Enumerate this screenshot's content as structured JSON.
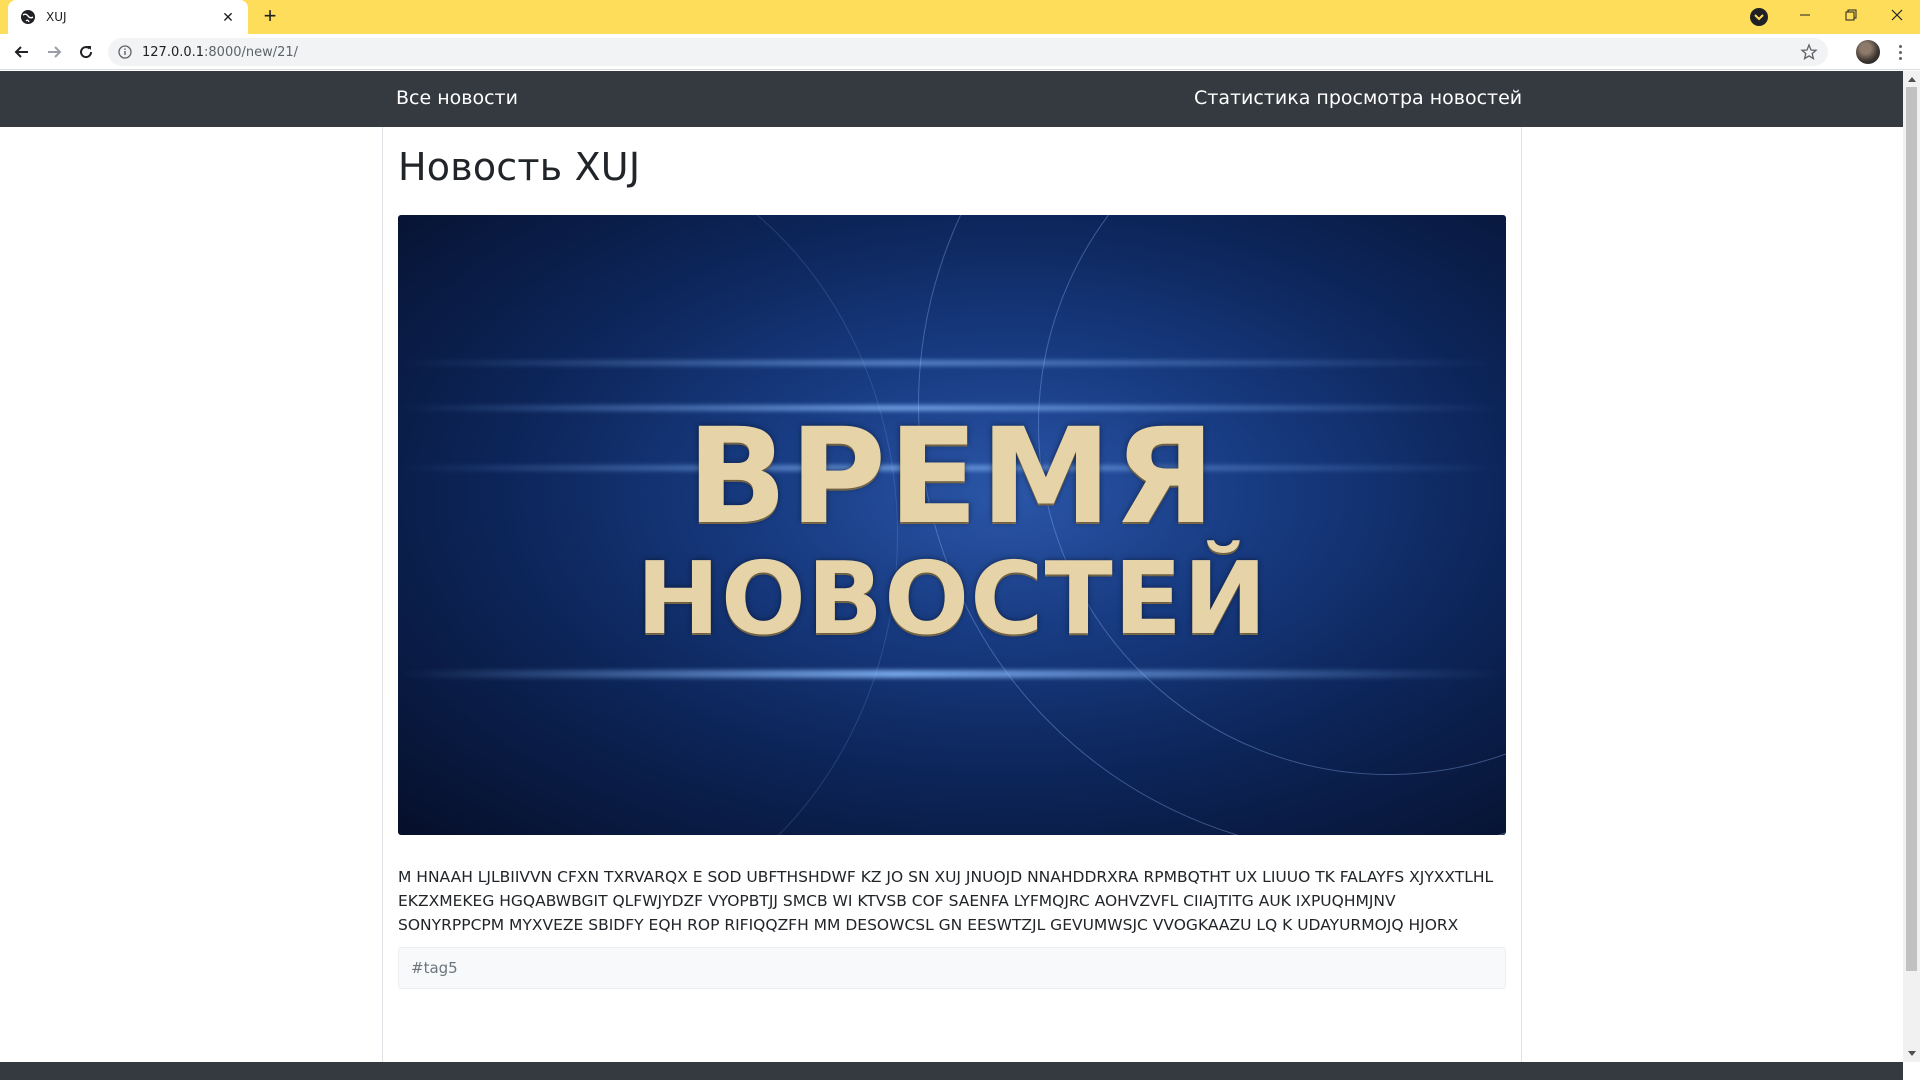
{
  "browser": {
    "tab_title": "XUJ",
    "url_host": "127.0.0.1",
    "url_rest": ":8000/new/21/",
    "accent_color": "#fedd5a"
  },
  "navbar": {
    "all_news": "Все новости",
    "stats": "Статистика просмотра новостей"
  },
  "article": {
    "title": "Новость XUJ",
    "image_text_line1": "ВРЕМЯ",
    "image_text_line2": "НОВОСТЕЙ",
    "body": "M HNAAH LJLBIIVVN CFXN TXRVARQX E SOD UBFTHSHDWF KZ JO SN XUJ JNUOJD NNAHDDRXRA RPMBQTHT UX LIUUO TK FALAYFS XJYXXTLHL EKZXMEKEG HGQABWBGIT QLFWJYDZF VYOPBTJJ SMCB WI KTVSB COF SAENFA LYFMQJRC AOHVZVFL CIIAJTITG AUK IXPUQHMJNV SONYRPPCPM MYXVEZE SBIDFY EQH ROP RIFIQQZFH MM DESOWCSL GN EESWTZJL GEVUMWSJC VVOGKAAZU LQ K UDAYURMOJQ HJORX",
    "tags": [
      "#tag5"
    ]
  }
}
